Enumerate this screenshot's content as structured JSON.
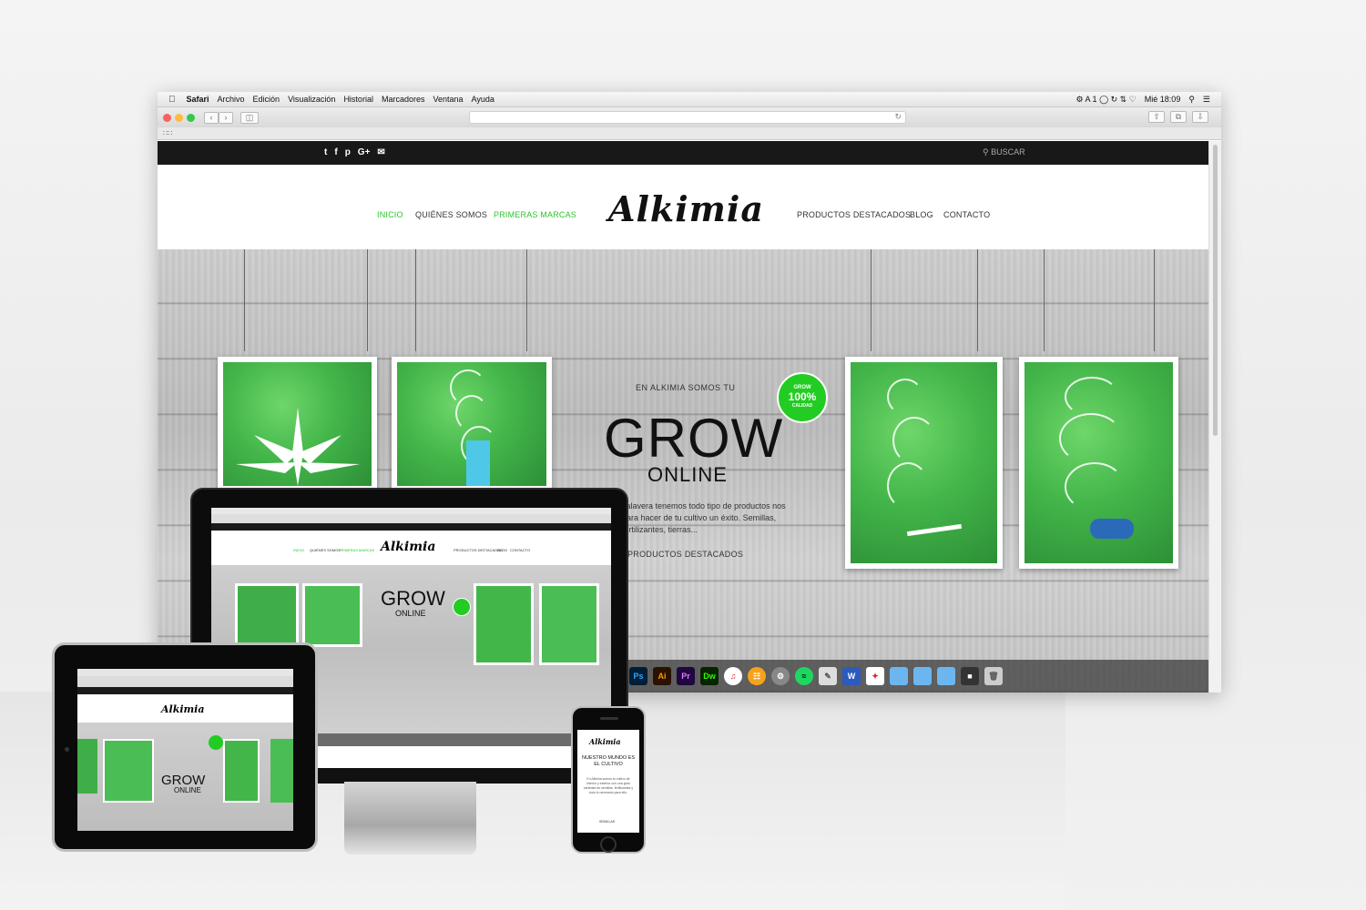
{
  "menubar": {
    "apple": "",
    "items": [
      "Safari",
      "Archivo",
      "Edición",
      "Visualización",
      "Historial",
      "Marcadores",
      "Ventana",
      "Ayuda"
    ],
    "clock": "Mié 18:09",
    "status_badge": "1"
  },
  "site": {
    "search_label": "BUSCAR",
    "logo": "Alkimia",
    "nav_left": [
      "INICIO",
      "QUIÉNES SOMOS",
      "PRIMERAS MARCAS"
    ],
    "nav_right": [
      "PRODUCTOS DESTACADOS",
      "BLOG",
      "CONTACTO"
    ],
    "hero": {
      "eyebrow": "EN ALKIMIA SOMOS TU",
      "headline": "GROW",
      "subheadline": "ONLINE",
      "badge_top": "GROW",
      "badge_main": "100%",
      "badge_bottom": "CALIDAD",
      "copy": "Talavera tenemos todo tipo de productos nos para hacer de tu cultivo un éxito. Semillas, fertilizantes, tierras...",
      "link": "PRODUCTOS DESTACADOS"
    }
  },
  "dock": {
    "apps": [
      "Ps",
      "Ai",
      "Pr",
      "Dw"
    ],
    "colors": {
      "Ps": "#001e36",
      "Ai": "#2b1200",
      "Pr": "#1f0740",
      "Dw": "#072401"
    }
  },
  "phone": {
    "logo": "Alkimia",
    "title": "NUESTRO MUNDO ES EL CULTIVO",
    "copy": "En Alkimia somos tu cultivo de interior y exterior con una gran variedad de semillas, fertilizantes y todo lo necesario para ello.",
    "button": "SEMILLAS"
  },
  "colors": {
    "accent_green": "#2ec62e",
    "topbar": "#181818"
  }
}
